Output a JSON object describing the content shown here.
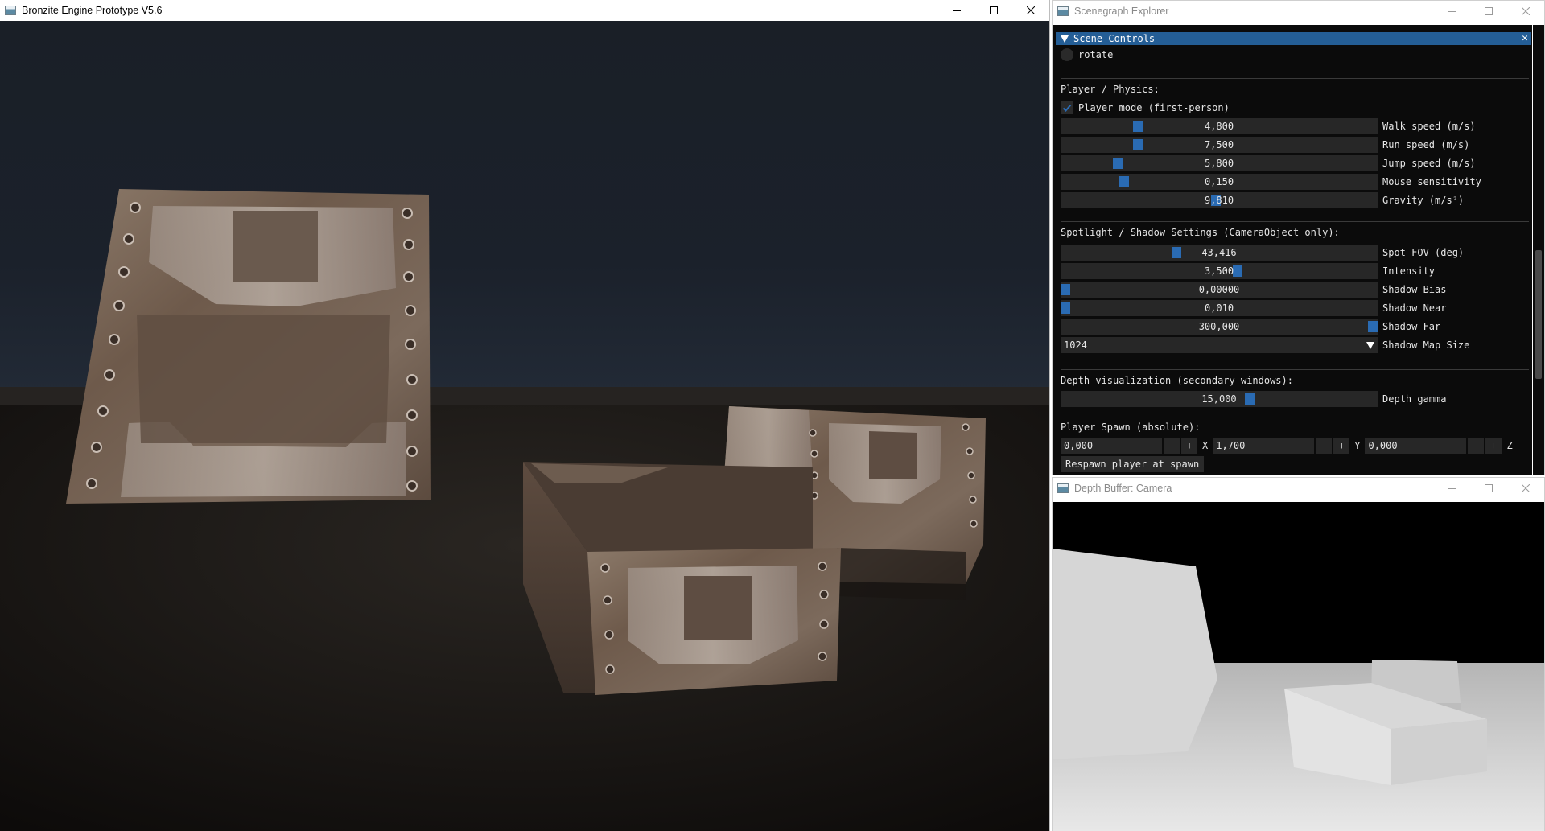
{
  "main_window": {
    "title": "Bronzite Engine Prototype V5.6",
    "buttons": {
      "minimize": "minimize-icon",
      "maximize": "maximize-icon",
      "close": "close-icon"
    }
  },
  "explorer": {
    "title": "Scenegraph Explorer",
    "header": "Scene Controls",
    "rotate_label": "rotate",
    "player_section": "Player / Physics:",
    "player_mode_label": "Player mode (first-person)",
    "player_mode_checked": true,
    "player_sliders": [
      {
        "value": "4,800",
        "label": "Walk speed (m/s)",
        "fill": 0.235
      },
      {
        "value": "7,500",
        "label": "Run speed (m/s)",
        "fill": 0.235
      },
      {
        "value": "5,800",
        "label": "Jump speed (m/s)",
        "fill": 0.17
      },
      {
        "value": "0,150",
        "label": "Mouse sensitivity",
        "fill": 0.19
      },
      {
        "value": "9,810",
        "label": "Gravity (m/s²)",
        "fill": 0.49
      }
    ],
    "spot_section": "Spotlight / Shadow Settings (CameraObject only):",
    "spot_sliders": [
      {
        "value": "43,416",
        "label": "Spot FOV (deg)",
        "fill": 0.36
      },
      {
        "value": "3,500",
        "label": "Intensity",
        "fill": 0.56
      },
      {
        "value": "0,00000",
        "label": "Shadow Bias",
        "fill": 0.0
      },
      {
        "value": "0,010",
        "label": "Shadow Near",
        "fill": 0.0
      },
      {
        "value": "300,000",
        "label": "Shadow Far",
        "fill": 1.0
      }
    ],
    "shadow_map": {
      "value": "1024",
      "label": "Shadow Map Size"
    },
    "depth_section": "Depth visualization (secondary windows):",
    "depth_slider": {
      "value": "15,000",
      "label": "Depth gamma",
      "fill": 0.6
    },
    "spawn_section": "Player Spawn (absolute):",
    "spawn": [
      {
        "value": "0,000",
        "axis": "X"
      },
      {
        "value": "1,700",
        "axis": "Y"
      },
      {
        "value": "0,000",
        "axis": "Z"
      }
    ],
    "stepper_minus": "-",
    "stepper_plus": "+",
    "respawn_button": "Respawn player at spawn",
    "close_glyph": "✕"
  },
  "depth_window": {
    "title": "Depth Buffer: Camera"
  },
  "colors": {
    "accent": "#245e96",
    "slider_grab": "#2a6bb3",
    "panel_bg": "#0b0b0b",
    "frame_bg": "#272727"
  }
}
